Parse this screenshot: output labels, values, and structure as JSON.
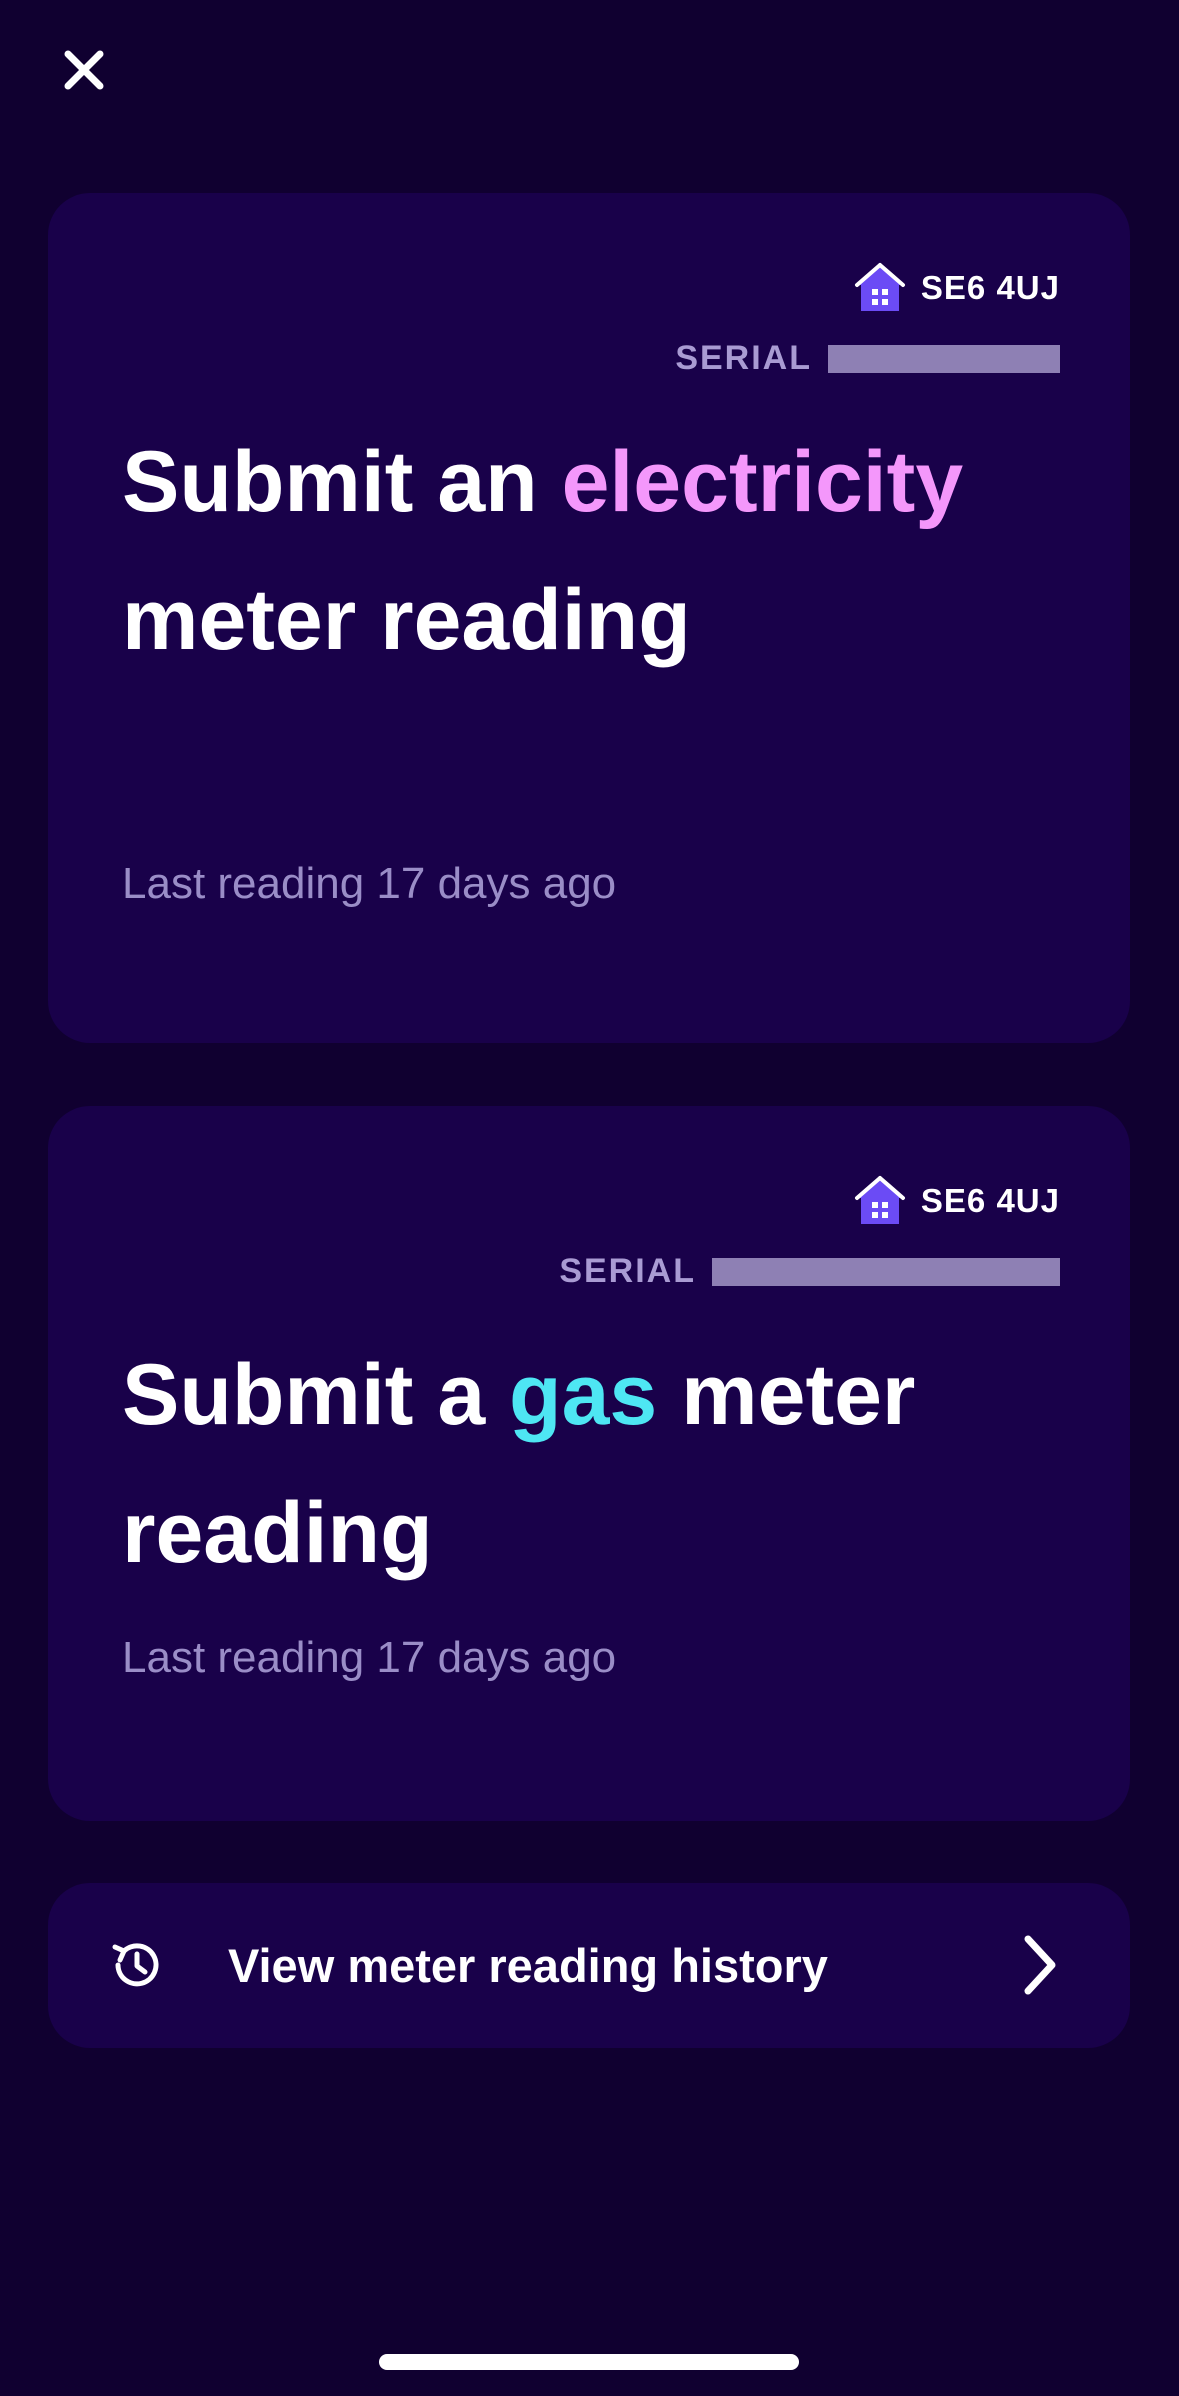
{
  "colors": {
    "background": "#100030",
    "card": "#19014a",
    "electricity_accent": "#f497fb",
    "gas_accent": "#4ee6f3",
    "house_icon": "#6b4bf5"
  },
  "close": {
    "icon": "close-icon"
  },
  "electricity_card": {
    "postcode": "SE6 4UJ",
    "serial_label": "SERIAL",
    "title_before": "Submit an ",
    "title_accent": "electricity",
    "title_after": " meter reading",
    "last_reading": "Last reading 17 days ago"
  },
  "gas_card": {
    "postcode": "SE6 4UJ",
    "serial_label": "SERIAL",
    "title_before": "Submit a ",
    "title_accent": "gas",
    "title_after": " meter reading",
    "last_reading": "Last reading 17 days ago"
  },
  "history": {
    "label": "View meter reading history",
    "icon": "history-icon",
    "chevron": "chevron-right-icon"
  }
}
